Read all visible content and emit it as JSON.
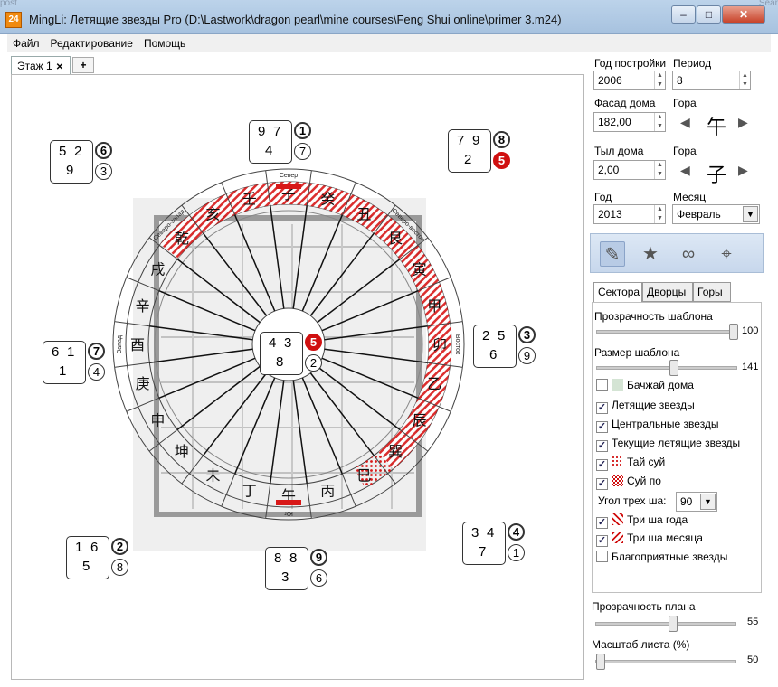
{
  "window": {
    "title": "MingLi: Летящие звезды Pro (D:\\Lastwork\\dragon pearl\\mine courses\\Feng Shui online\\primer 3.m24)",
    "app_icon": "24",
    "ghost_left": "post",
    "ghost_right": "Sear",
    "controls": [
      "–",
      "□",
      "✕"
    ]
  },
  "menu": [
    "Файл",
    "Редактирование",
    "Помощь"
  ],
  "tabs": {
    "active": "Этаж 1",
    "close": "✕",
    "add": "+"
  },
  "chart": {
    "palaces": [
      {
        "id": "nw",
        "a": "5",
        "b": "2",
        "c": "9",
        "bold": "6",
        "thin": "3",
        "red": false
      },
      {
        "id": "n",
        "a": "9",
        "b": "7",
        "c": "4",
        "bold": "1",
        "thin": "7",
        "red": false
      },
      {
        "id": "ne",
        "a": "7",
        "b": "9",
        "c": "2",
        "bold": "8",
        "thin": "5",
        "red": true
      },
      {
        "id": "w",
        "a": "6",
        "b": "1",
        "c": "1",
        "bold": "7",
        "thin": "4",
        "red": false
      },
      {
        "id": "c",
        "a": "4",
        "b": "3",
        "c": "8",
        "bold": "5",
        "thin": "2",
        "red": true
      },
      {
        "id": "e",
        "a": "2",
        "b": "5",
        "c": "6",
        "bold": "3",
        "thin": "9",
        "red": false
      },
      {
        "id": "sw",
        "a": "1",
        "b": "6",
        "c": "5",
        "bold": "2",
        "thin": "8",
        "red": false
      },
      {
        "id": "s",
        "a": "8",
        "b": "8",
        "c": "3",
        "bold": "9",
        "thin": "6",
        "red": false
      },
      {
        "id": "se",
        "a": "3",
        "b": "4",
        "c": "7",
        "bold": "4",
        "thin": "1",
        "red": false
      }
    ],
    "directions": {
      "n": "Север",
      "s": "Юг",
      "w": "Запад",
      "e": "Восток",
      "nw": "Северо-запад",
      "ne": "Северо-восток"
    },
    "mountains": [
      "子",
      "癸",
      "丑",
      "艮",
      "寅",
      "甲",
      "卯",
      "乙",
      "辰",
      "巽",
      "巳",
      "丙",
      "午",
      "丁",
      "未",
      "坤",
      "申",
      "庚",
      "酉",
      "辛",
      "戌",
      "乾",
      "亥",
      "壬"
    ]
  },
  "controls": {
    "build_year_label": "Год постройки",
    "build_year": "2006",
    "period_label": "Период",
    "period": "8",
    "facade_label": "Фасад дома",
    "facade": "182,00",
    "mountain_label": "Гора",
    "facade_mountain": "午",
    "back_label": "Тыл дома",
    "back": "2,00",
    "back_mountain": "子",
    "year_label": "Год",
    "year": "2013",
    "month_label": "Месяц",
    "month": "Февраль"
  },
  "toolbar_icons": [
    "pencil-icon",
    "star-icon",
    "link-icon",
    "compass-icon"
  ],
  "panel_tabs": [
    "Сектора",
    "Дворцы",
    "Горы"
  ],
  "sectors": {
    "opacity_label": "Прозрачность шаблона",
    "opacity_value": "100",
    "opacity_frac": 1.0,
    "size_label": "Размер шаблона",
    "size_value": "141",
    "size_frac": 0.55,
    "checks": [
      {
        "label": "Бачжай дома",
        "checked": false,
        "swatch": "#d4e4d4"
      },
      {
        "label": "Летящие звезды",
        "checked": true,
        "swatch": ""
      },
      {
        "label": "Центральные звезды",
        "checked": true,
        "swatch": ""
      },
      {
        "label": "Текущие летящие звезды",
        "checked": true,
        "swatch": ""
      },
      {
        "label": "Тай суй",
        "checked": true,
        "swatch": "dots"
      },
      {
        "label": "Суй по",
        "checked": true,
        "swatch": "check"
      },
      {
        "label": "Три ша года",
        "checked": true,
        "swatch": "hatch1"
      },
      {
        "label": "Три ша месяца",
        "checked": true,
        "swatch": "hatch2"
      },
      {
        "label": "Благоприятные звезды",
        "checked": false,
        "swatch": ""
      }
    ],
    "angle_label": "Угол трех ша:",
    "angle_value": "90"
  },
  "plan": {
    "opacity_label": "Прозрачность плана",
    "opacity_value": "55",
    "opacity_frac": 0.55,
    "scale_label": "Масштаб листа (%)",
    "scale_value": "50",
    "scale_frac": 0.0
  }
}
